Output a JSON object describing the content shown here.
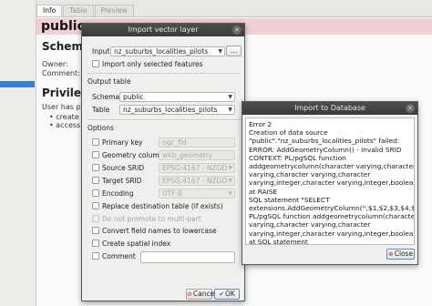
{
  "background": {
    "tabs": [
      "Info",
      "Table",
      "Preview"
    ],
    "title": "public",
    "schema_heading": "Schema",
    "owner_label": "Owner:",
    "comment_label": "Comment:",
    "privileges_heading": "Privilege",
    "privileges_text": "User has privi",
    "bullet_1": "• create ne",
    "bullet_2": "• access ob"
  },
  "import_dialog": {
    "title": "Import vector layer",
    "input_label": "Input",
    "input_value": "nz_suburbs_localities_pilots",
    "browse_label": "...",
    "only_selected_label": "Import only selected features",
    "output_table_label": "Output table",
    "schema_label": "Schema",
    "schema_value": "public",
    "table_label": "Table",
    "table_value": "nz_suburbs_localities_pilots",
    "options_label": "Options",
    "primary_key_label": "Primary key",
    "primary_key_value": "ogc_fid",
    "geometry_column_label": "Geometry column",
    "geometry_column_value": "wkb_geometry",
    "source_srid_label": "Source SRID",
    "source_srid_value": "EPSG:4167 - NZGD",
    "target_srid_label": "Target SRID",
    "target_srid_value": "EPSG:4167 - NZGD",
    "encoding_label": "Encoding",
    "encoding_value": "UTF-8",
    "replace_label": "Replace destination table (if exists)",
    "no_multipart_label": "Do not promote to multi-part",
    "lowercase_label": "Convert field names to lowercase",
    "spatial_index_label": "Create spatial index",
    "comment_label": "Comment",
    "cancel_label": "Cancel",
    "ok_label": "OK"
  },
  "message": {
    "title": "Import to Database",
    "lines": [
      "Error 2",
      "Creation of data source",
      "\"public\".\"nz_suburbs_localities_pilots\" failed:",
      "ERROR:  AddGeometryColumn() - invalid SRID",
      "CONTEXT:  PL/pgSQL function",
      "addgeometrycolumn(character varying,character",
      "varying,character varying,character",
      "varying,integer,character varying,integer,boolean) line 50",
      "at RAISE",
      "SQL statement \"SELECT",
      "extensions.AddGeometryColumn('',$1,$2,$3,$4,$5,$6,$7)\"",
      "PL/pgSQL function addgeometrycolumn(character",
      "varying,character varying,character",
      "varying,integer,character varying,integer,boolean) line 5",
      "at SQL statement"
    ],
    "close_label": "Close"
  }
}
